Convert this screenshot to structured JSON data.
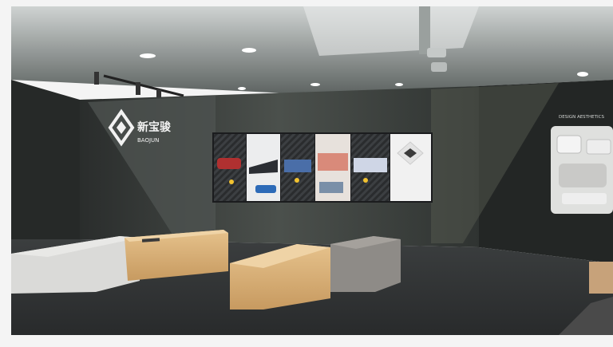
{
  "brand": {
    "name_cn": "新宝骏",
    "name_en": "BAOJUN"
  },
  "wall_text": {
    "design_aesthetics": "DESIGN AESTHETICS"
  },
  "colors": {
    "wall": "#3b3f3c",
    "floor": "#2f3233",
    "ceiling": "#d9dcd9",
    "accent_light": "#c7e0b6",
    "wood": "#d8b27a",
    "bench_grey": "#9a9794"
  }
}
